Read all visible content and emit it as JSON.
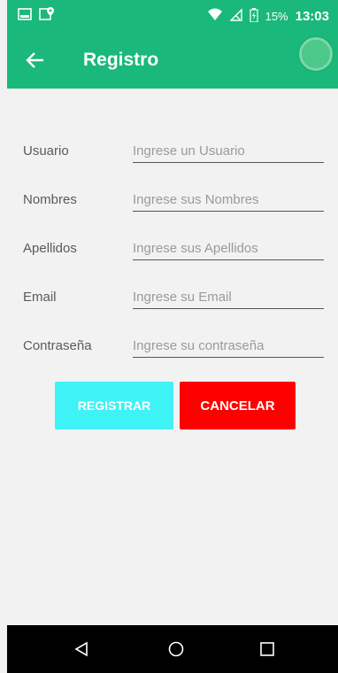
{
  "status_bar": {
    "battery_percent": "15%",
    "time": "13:03",
    "icons": [
      "gallery-icon",
      "location-icon",
      "wifi-icon",
      "no-signal-icon",
      "battery-icon"
    ]
  },
  "app_bar": {
    "title": "Registro",
    "background": "#1ab87a"
  },
  "form": {
    "fields": [
      {
        "label": "Usuario",
        "placeholder": "Ingrese un Usuario",
        "value": ""
      },
      {
        "label": "Nombres",
        "placeholder": "Ingrese sus Nombres",
        "value": ""
      },
      {
        "label": "Apellidos",
        "placeholder": "Ingrese sus Apellidos",
        "value": ""
      },
      {
        "label": "Email",
        "placeholder": "Ingrese su Email",
        "value": ""
      },
      {
        "label": "Contraseña",
        "placeholder": "Ingrese su contraseña",
        "value": ""
      }
    ]
  },
  "buttons": {
    "register_label": "REGISTRAR",
    "register_color": "#3ef2f6",
    "cancel_label": "CANCELAR",
    "cancel_color": "#ff0000"
  },
  "nav_bar": {
    "icons": [
      "back-triangle-icon",
      "home-circle-icon",
      "recents-square-icon"
    ]
  }
}
